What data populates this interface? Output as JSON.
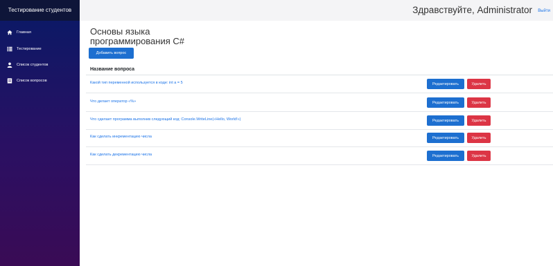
{
  "sidebar": {
    "brand": "Тестирование студентов",
    "items": [
      {
        "label": "Главная",
        "icon": "home-icon"
      },
      {
        "label": "Тестирование",
        "icon": "list-icon"
      },
      {
        "label": "Список студентов",
        "icon": "user-icon"
      },
      {
        "label": "Список вопросов",
        "icon": "document-icon"
      }
    ]
  },
  "header": {
    "greeting": "Здравствуйте, Administrator",
    "logout": "Выйти"
  },
  "main": {
    "title": "Основы языка программирования C#",
    "add_button": "Добавить вопрос",
    "column_header": "Название вопроса",
    "edit_label": "Редактировать",
    "delete_label": "Удалить",
    "questions": [
      "Какой тип переменной используется в коде: int a = 5",
      "Что делает оператор «%»",
      "Что сделает программа выполнив следующий код: Console.WriteLine(«Hello, World!»)",
      "Как сделать инкрементацию числа",
      "Как сделать декрементацию числа"
    ]
  },
  "colors": {
    "primary": "#1d6fd0",
    "danger": "#dc3545",
    "link": "#1a73e8",
    "brand_bg": "#0e1539"
  }
}
